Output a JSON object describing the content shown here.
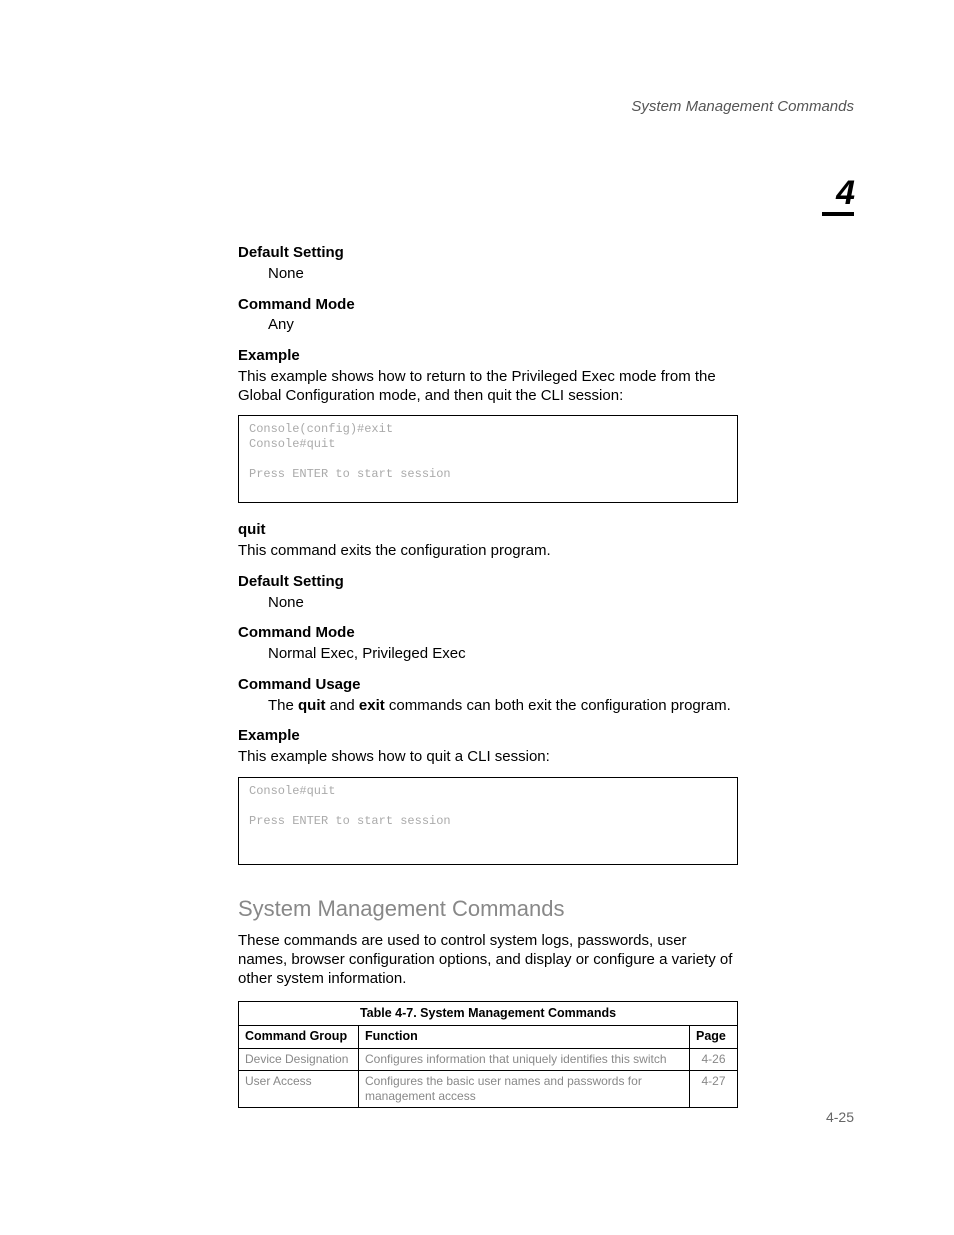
{
  "running_head": "System Management Commands",
  "chapter_number": "4",
  "sections": {
    "default_setting_1": {
      "heading": "Default Setting",
      "value": "None"
    },
    "command_mode_1": {
      "heading": "Command Mode",
      "value": "Any"
    },
    "example_1": {
      "heading": "Example",
      "text": "This example shows how to return to the Privileged Exec mode from the Global Configuration mode, and then quit the CLI session:",
      "code": "Console(config)#exit\nConsole#quit\n\nPress ENTER to start session"
    },
    "quit_heading": "quit",
    "quit_desc": "This command exits the configuration program.",
    "default_setting_2": {
      "heading": "Default Setting",
      "value": "None"
    },
    "command_mode_2": {
      "heading": "Command Mode",
      "value": "Normal Exec, Privileged Exec"
    },
    "command_usage": {
      "heading": "Command Usage",
      "pre": "The ",
      "kw1": "quit",
      "mid": " and ",
      "kw2": "exit",
      "post": " commands can both exit the configuration program."
    },
    "example_2": {
      "heading": "Example",
      "text": "This example shows how to quit a CLI session:",
      "code": "Console#quit\n\nPress ENTER to start session"
    },
    "h1": "System Management Commands",
    "intro_para": "These commands are used to control system logs, passwords, user names, browser configuration options, and display or configure a variety of other system information.",
    "table": {
      "caption": "Table 4-7.  System Management Commands",
      "headers": {
        "c1": "Command Group",
        "c2": "Function",
        "c3": "Page"
      },
      "rows": [
        {
          "group": "Device Designation",
          "func": "Configures information that uniquely identifies this switch",
          "page": "4-26"
        },
        {
          "group": "User Access",
          "func": "Configures the basic user names and passwords for management access",
          "page": "4-27"
        }
      ]
    }
  },
  "footer_page": "4-25"
}
